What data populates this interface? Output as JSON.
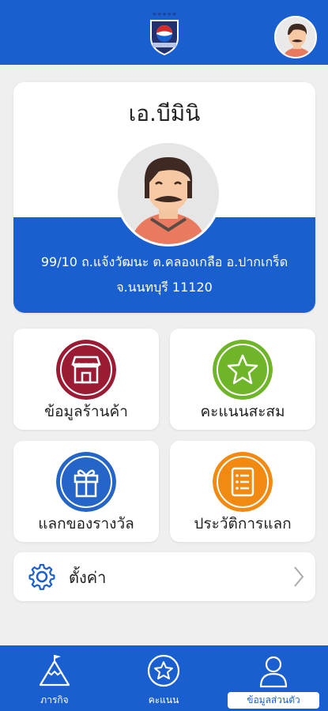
{
  "header": {
    "logo": "pepsi-shield-logo",
    "avatar_icon": "user-avatar-icon"
  },
  "profile": {
    "name": "เอ.บีมินิ",
    "address_line1": "99/10 ถ.แจ้งวัฒนะ ต.คลองเกลือ อ.ปากเกร็ด",
    "address_line2": "จ.นนทบุรี 11120"
  },
  "tiles": [
    {
      "label": "ข้อมูลร้านค้า",
      "icon": "store-icon",
      "color": "#9b1a34"
    },
    {
      "label": "คะแนนสะสม",
      "icon": "star-icon",
      "color": "#6fb52a"
    },
    {
      "label": "แลกของรางวัล",
      "icon": "gift-icon",
      "color": "#2565c7"
    },
    {
      "label": "ประวัติการแลก",
      "icon": "list-icon",
      "color": "#f28a12"
    }
  ],
  "settings": {
    "label": "ตั้งค่า",
    "icon": "gear-icon"
  },
  "bottom_nav": [
    {
      "label": "ภารกิจ",
      "icon": "mountain-flag-icon",
      "active": false
    },
    {
      "label": "คะแนน",
      "icon": "star-circle-icon",
      "active": false
    },
    {
      "label": "ข้อมูลส่วนตัว",
      "icon": "person-icon",
      "active": true
    }
  ],
  "colors": {
    "primary": "#1a5fd0",
    "background": "#efefef"
  }
}
